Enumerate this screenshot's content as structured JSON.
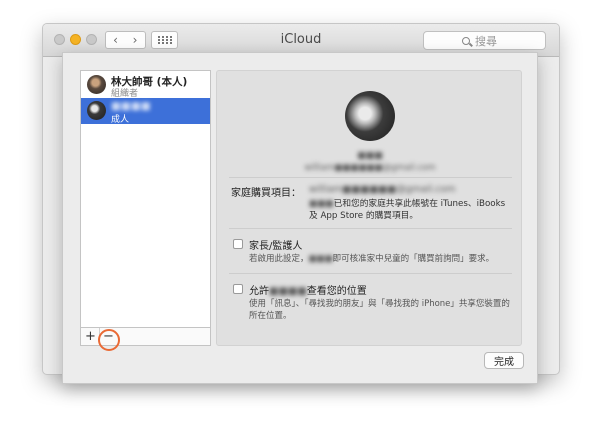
{
  "window": {
    "title": "iCloud",
    "search_placeholder": "搜尋",
    "nav_back": "‹",
    "nav_forward": "›"
  },
  "members": [
    {
      "name": "林大帥哥 (本人)",
      "role": "組織者",
      "selected": false
    },
    {
      "name": "■■■■",
      "role": "成人",
      "selected": true
    }
  ],
  "list_toolbar": {
    "add": "+",
    "remove": "−"
  },
  "profile": {
    "name": "■■■",
    "email": "william■■■■■■@gmail.com"
  },
  "purchases": {
    "label": "家庭購買項目：",
    "email": "william■■■■■■@gmail.com",
    "desc_prefix": "■■■",
    "desc": "已和您的家庭共享此帳號在 iTunes、iBooks 及 App Store 的購買項目。"
  },
  "parent_option": {
    "title": "家長/監護人",
    "desc_pre": "若啟用此設定，",
    "desc_blur": "■■■",
    "desc_post": "即可核准家中兒童的「購買前詢問」要求。"
  },
  "location_option": {
    "title_pre": "允許",
    "title_blur": "■■■■",
    "title_post": "查看您的位置",
    "desc": "使用「訊息」、「尋找我的朋友」與「尋找我的 iPhone」共享您裝置的所在位置。"
  },
  "buttons": {
    "done": "完成"
  },
  "colors": {
    "selection": "#3d70d9",
    "highlight_ring": "#ea6a35",
    "minimize": "#f5b324"
  }
}
